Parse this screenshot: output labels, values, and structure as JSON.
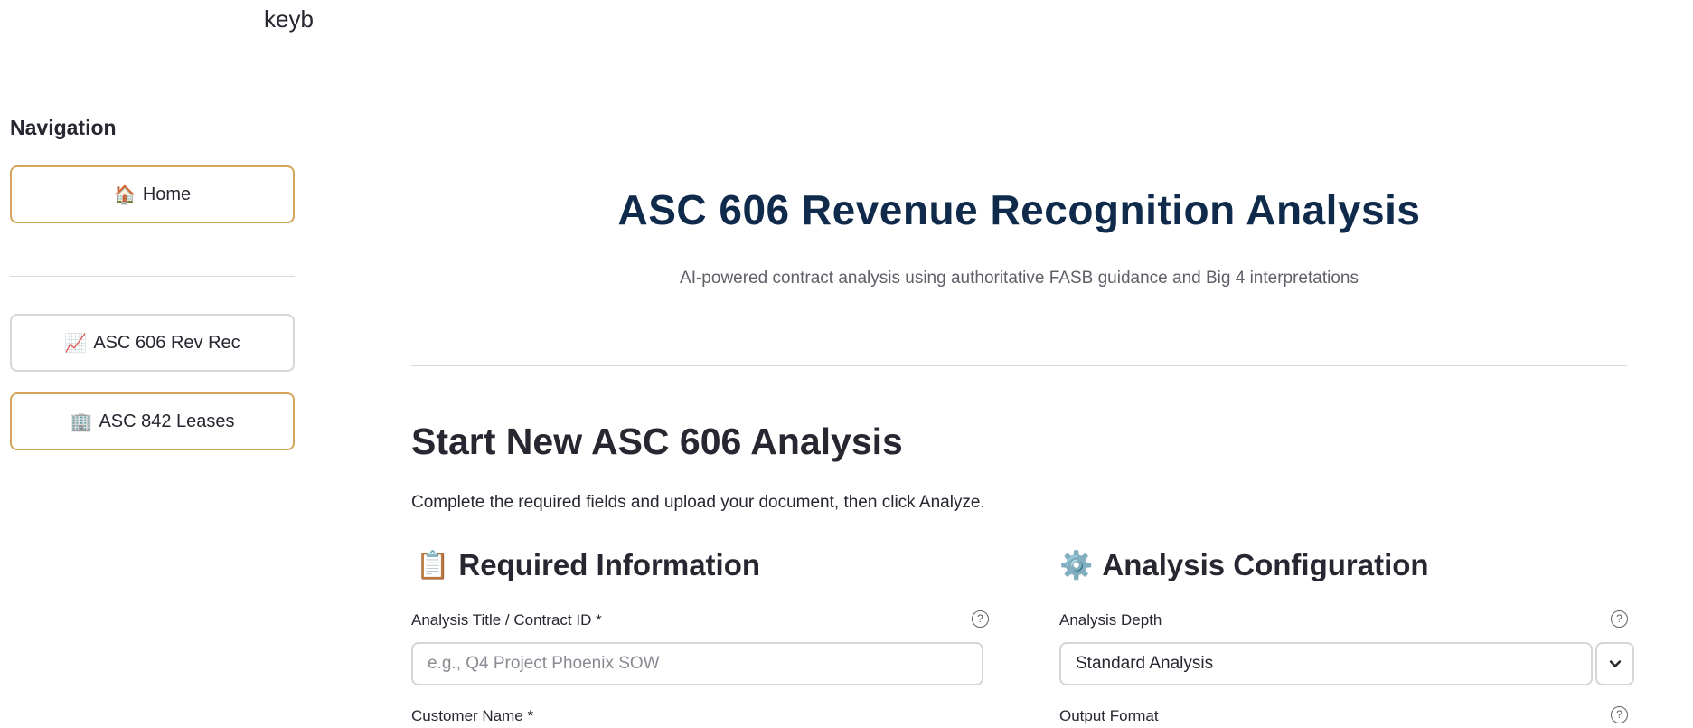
{
  "sidebar": {
    "clipped_text": "keyb",
    "heading": "Navigation",
    "items": [
      {
        "icon": "house-icon",
        "glyph": "🏠",
        "label": "Home"
      },
      {
        "icon": "chart-increasing-icon",
        "glyph": "📈",
        "label": "ASC 606 Rev Rec"
      },
      {
        "icon": "office-building-icon",
        "glyph": "🏢",
        "label": "ASC 842 Leases"
      }
    ]
  },
  "header": {
    "title": "ASC 606 Revenue Recognition Analysis",
    "subtitle": "AI-powered contract analysis using authoritative FASB guidance and Big 4 interpretations"
  },
  "section": {
    "title": "Start New ASC 606 Analysis",
    "description": "Complete the required fields and upload your document, then click Analyze."
  },
  "required": {
    "icon": "clipboard-icon",
    "glyph": "📋",
    "heading": "Required Information",
    "title_label": "Analysis Title / Contract ID *",
    "title_placeholder": "e.g., Q4 Project Phoenix SOW",
    "title_value": "",
    "customer_label": "Customer Name *"
  },
  "config": {
    "icon": "gear-icon",
    "glyph": "⚙️",
    "heading": "Analysis Configuration",
    "depth_label": "Analysis Depth",
    "depth_value": "Standard Analysis",
    "output_label": "Output Format"
  },
  "help_glyph": "?",
  "colors": {
    "accent_border": "#d4a55b",
    "title_navy": "#0f2a4a"
  }
}
